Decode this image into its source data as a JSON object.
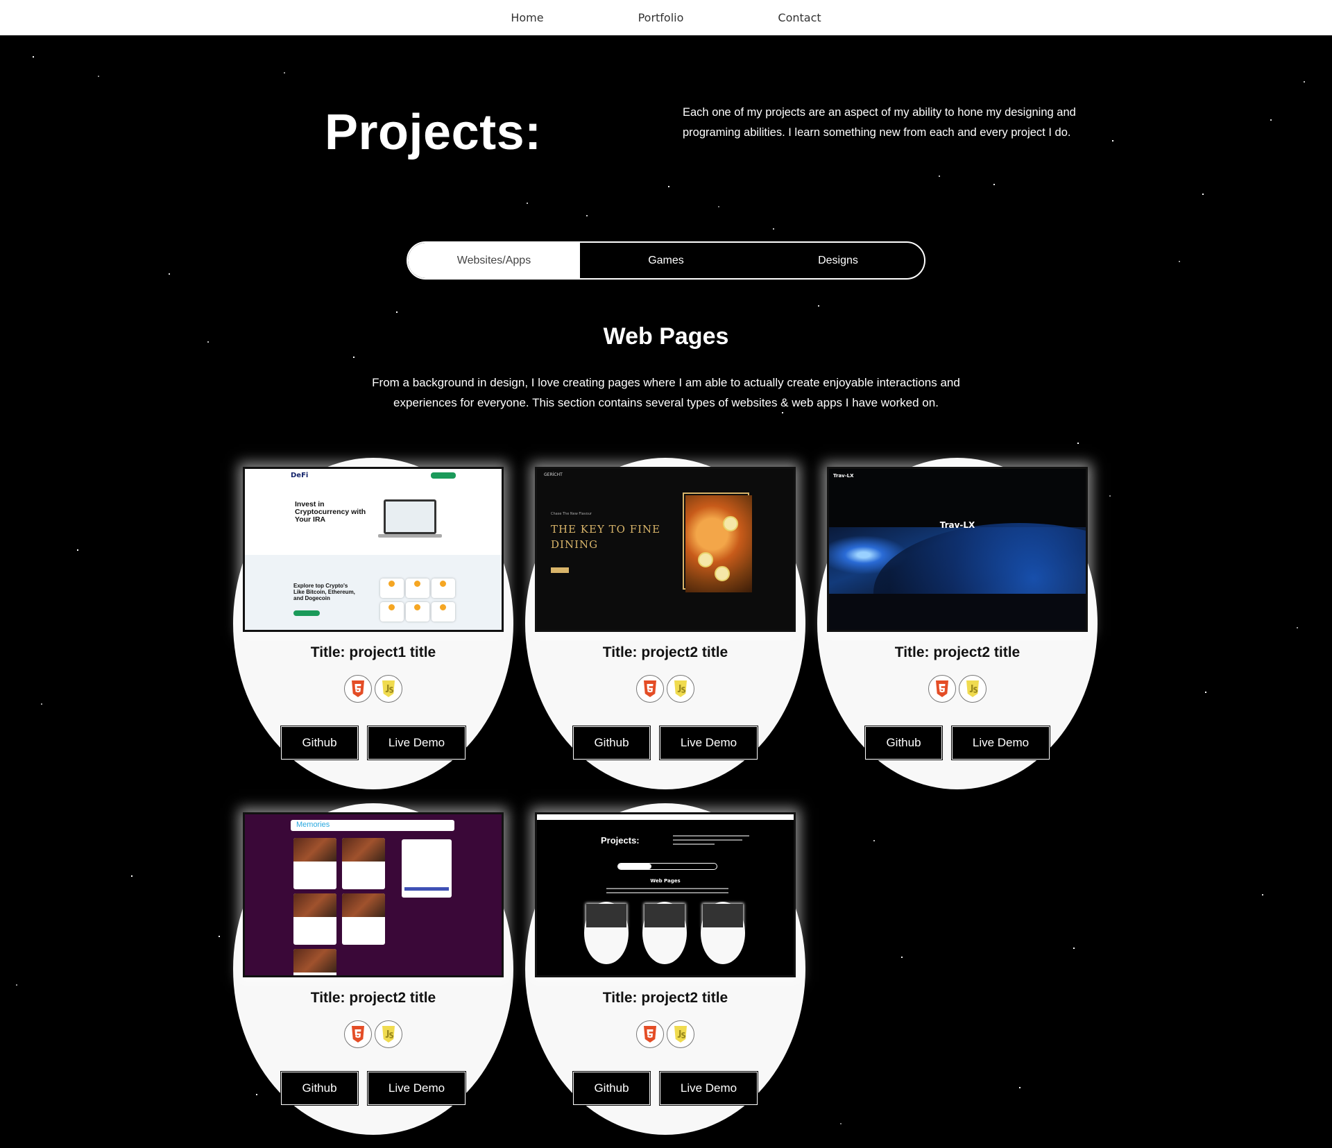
{
  "nav": {
    "items": [
      "Home",
      "Portfolio",
      "Contact"
    ]
  },
  "header": {
    "title": "Projects:",
    "intro": "Each one of my projects are an aspect of my ability to hone my designing and programing abilities. I learn something new from each and every project I do."
  },
  "tabs": {
    "items": [
      "Websites/Apps",
      "Games",
      "Designs"
    ],
    "active": "Websites/Apps"
  },
  "section": {
    "title": "Web Pages",
    "description": "From a background in design, I love creating pages where I am able to actually create enjoyable interactions and experiences for everyone. This section contains several types of websites & web apps I have worked on."
  },
  "cards": [
    {
      "title": "Title: project1 title",
      "badges": [
        "html5-icon",
        "javascript-icon"
      ],
      "github": "Github",
      "demo": "Live Demo",
      "thumb": {
        "logo": "DeFi",
        "heading": "Invest in Cryptocurrency with Your IRA",
        "subheading": "Explore top Crypto's Like Bitcoin, Ethereum, and Dogecoin"
      }
    },
    {
      "title": "Title: project2 title",
      "badges": [
        "html5-icon",
        "javascript-icon"
      ],
      "github": "Github",
      "demo": "Live Demo",
      "thumb": {
        "brand": "GERÍCHT",
        "kicker": "Chase The New Flavour",
        "heading_line1": "THE KEY TO FINE",
        "heading_line2": "DINING"
      }
    },
    {
      "title": "Title: project2 title",
      "badges": [
        "html5-icon",
        "javascript-icon"
      ],
      "github": "Github",
      "demo": "Live Demo",
      "thumb": {
        "logo": "Trav-LX",
        "heading": "Trav-LX"
      }
    },
    {
      "title": "Title: project2 title",
      "badges": [
        "html5-icon",
        "javascript-icon"
      ],
      "github": "Github",
      "demo": "Live Demo",
      "thumb": {
        "logo": "Memories"
      }
    },
    {
      "title": "Title: project2 title",
      "badges": [
        "html5-icon",
        "javascript-icon"
      ],
      "github": "Github",
      "demo": "Live Demo",
      "thumb": {
        "heading": "Projects:",
        "subheading": "Web Pages"
      }
    }
  ],
  "colors": {
    "background": "#000000",
    "card": "#f8f8f8",
    "button": "#000000",
    "html5": "#e44d26",
    "javascript": "#f0db4f",
    "defi_green": "#1b9a5a",
    "dining_gold": "#d9b56a",
    "memories_bg": "#3a0838"
  }
}
